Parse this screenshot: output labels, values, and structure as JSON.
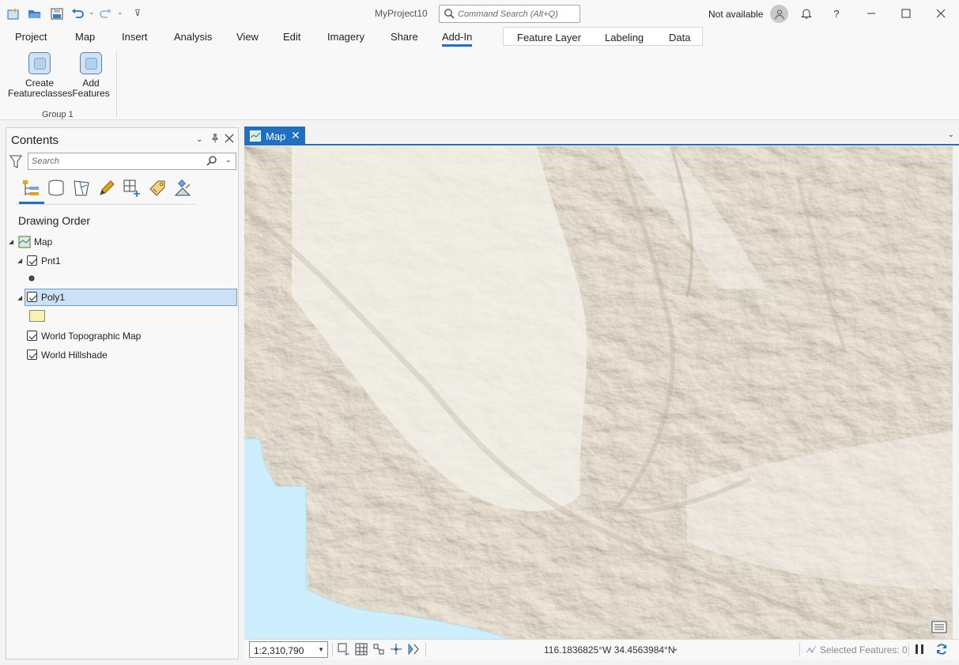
{
  "titlebar": {
    "project_name": "MyProject10",
    "command_search_placeholder": "Command Search (Alt+Q)",
    "user_status": "Not available"
  },
  "ribbon": {
    "tabs": [
      "Project",
      "Map",
      "Insert",
      "Analysis",
      "View",
      "Edit",
      "Imagery",
      "Share",
      "Add-In"
    ],
    "active_tab": "Add-In",
    "contextual_tabs": [
      "Feature Layer",
      "Labeling",
      "Data"
    ],
    "buttons": [
      {
        "line1": "Create",
        "line2": "Featureclasses"
      },
      {
        "line1": "Add",
        "line2": "Features"
      }
    ],
    "group_label": "Group 1"
  },
  "contents": {
    "title": "Contents",
    "search_placeholder": "Search",
    "section_title": "Drawing Order",
    "layers": {
      "map": "Map",
      "pnt1": "Pnt1",
      "poly1": "Poly1",
      "topo": "World Topographic Map",
      "hillshade": "World Hillshade"
    },
    "poly1_symbol_color": "#fbf1b3",
    "pnt1_symbol_color": "#3f5b3a"
  },
  "map_view": {
    "tab_label": "Map",
    "scale": "1:2,310,790",
    "coordinates": "116.1836825°W 34.4563984°N",
    "selected_features": "Selected Features: 0"
  },
  "colors": {
    "accent": "#1f70c1",
    "water": "#cdeefc",
    "land": "#f2efe8"
  }
}
